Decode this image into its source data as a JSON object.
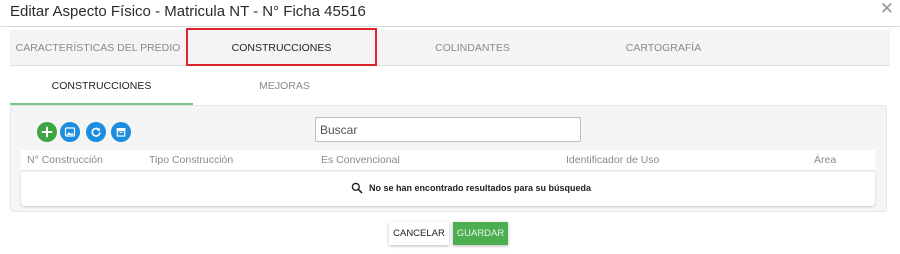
{
  "dialog": {
    "title": "Editar Aspecto Físico - Matricula NT - N° Ficha 45516",
    "close_icon": "close-icon"
  },
  "main_tabs": [
    {
      "label": "CARACTERÍSTICAS DEL PREDIO",
      "active": false
    },
    {
      "label": "CONSTRUCCIONES",
      "active": true,
      "highlighted": true
    },
    {
      "label": "COLINDANTES",
      "active": false
    },
    {
      "label": "CARTOGRAFÍA",
      "active": false
    }
  ],
  "sub_tabs": [
    {
      "label": "CONSTRUCCIONES",
      "active": true
    },
    {
      "label": "MEJORAS",
      "active": false
    }
  ],
  "toolbar": {
    "buttons": [
      {
        "icon": "add-icon",
        "color": "#3fa543"
      },
      {
        "icon": "image-icon",
        "color": "#1d8de0"
      },
      {
        "icon": "refresh-icon",
        "color": "#1d8de0"
      },
      {
        "icon": "archive-icon",
        "color": "#1d8de0"
      }
    ]
  },
  "search": {
    "placeholder": "Buscar"
  },
  "table": {
    "columns": [
      "N° Construcción",
      "Tipo Construcción",
      "Es Convencional",
      "Identificador de Uso",
      "Área"
    ],
    "empty_message": "No se han encontrado resultados para su búsqueda",
    "empty_icon": "search-icon"
  },
  "footer": {
    "cancel_label": "CANCELAR",
    "save_label": "GUARDAR"
  },
  "colors": {
    "highlight": "#e0242d",
    "accent_green": "#4dae51",
    "accent_blue": "#1d8de0"
  }
}
